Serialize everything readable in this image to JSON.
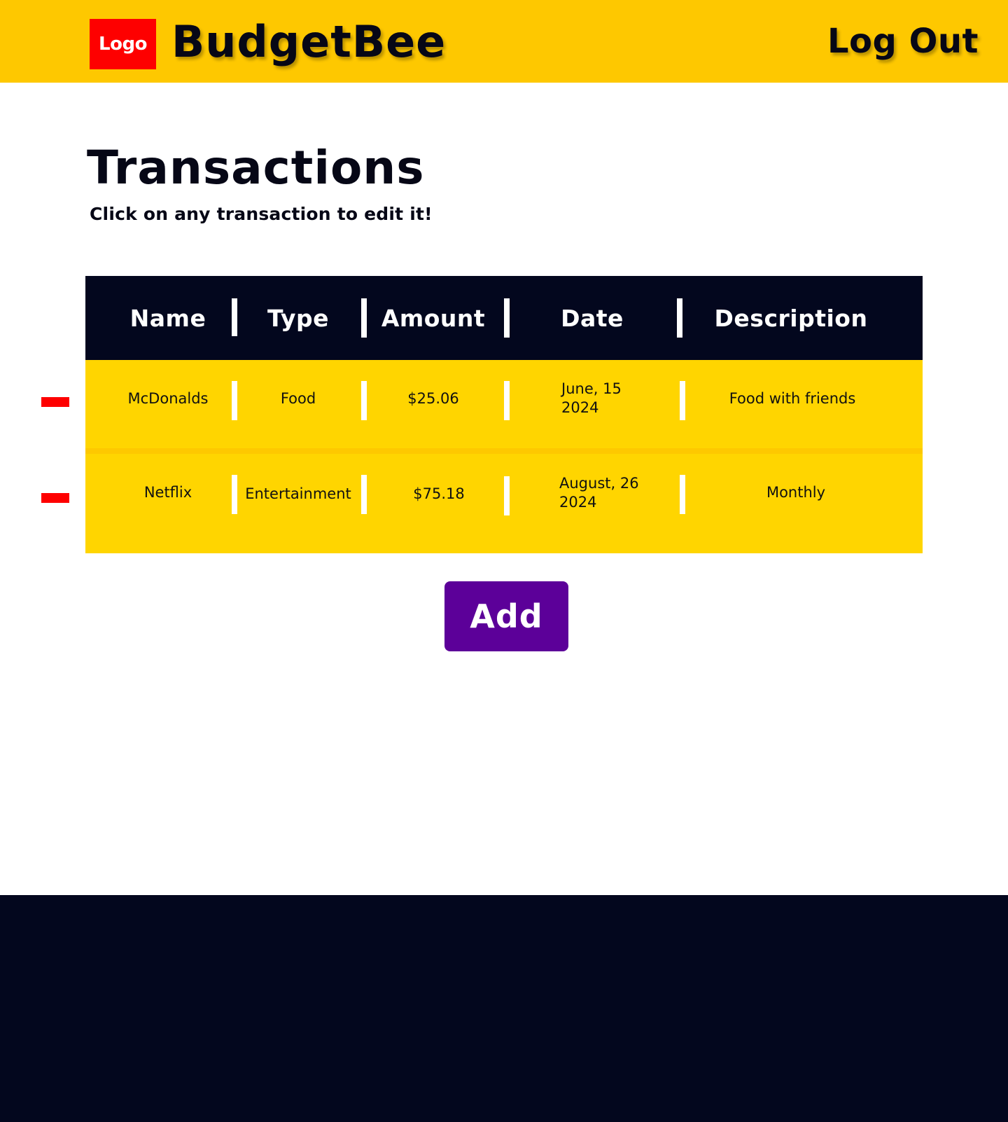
{
  "header": {
    "logo_text": "Logo",
    "app_name": "BudgetBee",
    "logout_label": "Log Out"
  },
  "page": {
    "title": "Transactions",
    "subtitle": "Click on any transaction to edit it!"
  },
  "table": {
    "columns": [
      "Name",
      "Type",
      "Amount",
      "Date",
      "Description"
    ],
    "rows": [
      {
        "name": "McDonalds",
        "type": "Food",
        "amount": "$25.06",
        "date": "June, 15 2024",
        "description": "Food with friends"
      },
      {
        "name": "Netflix",
        "type": "Entertainment",
        "amount": "$75.18",
        "date": "August, 26 2024",
        "description": "Monthly"
      }
    ]
  },
  "actions": {
    "add_label": "Add",
    "remove_icon": "minus-icon"
  },
  "colors": {
    "header_bg": "#FEC800",
    "row_bg": "#FFD500",
    "dark": "#03071E",
    "logo_red": "#FE0000",
    "add_purple": "#5C0099"
  }
}
